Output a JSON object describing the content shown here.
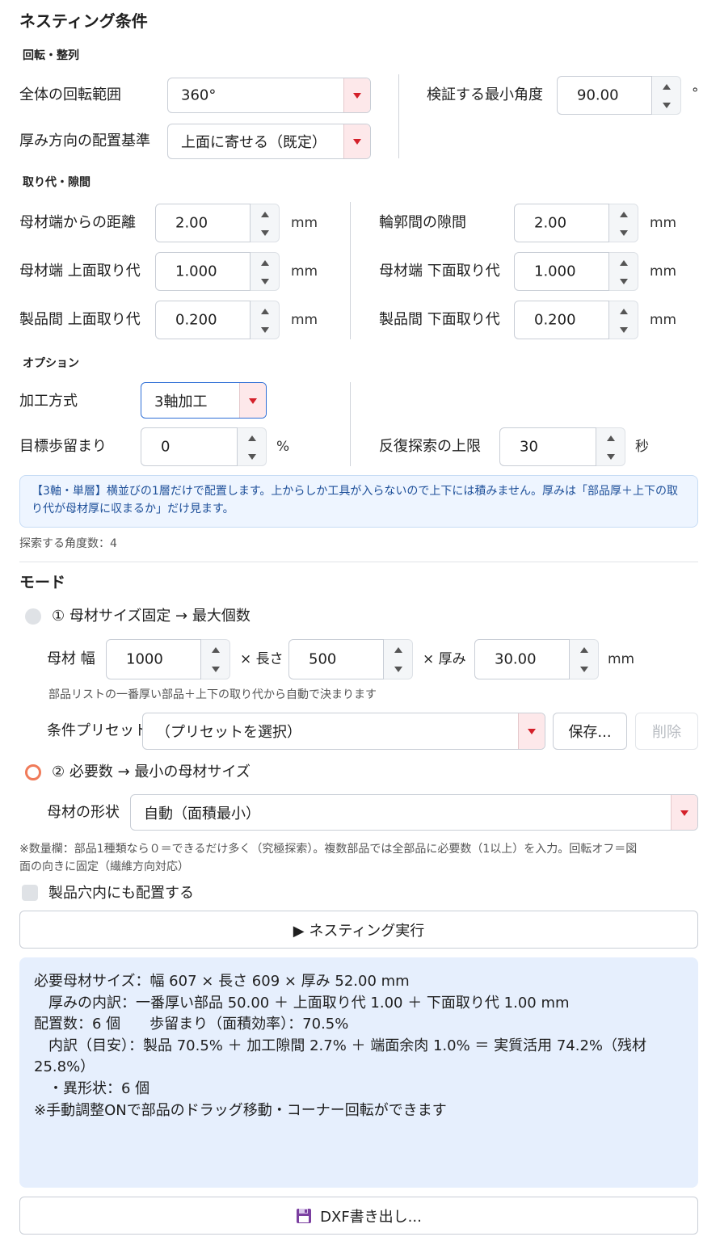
{
  "title": "ネスティング条件",
  "rotation_section": {
    "heading": "回転・整列",
    "overall_rotation_label": "全体の回転範囲",
    "overall_rotation_value": "360°",
    "thickness_align_label": "厚み方向の配置基準",
    "thickness_align_value": "上面に寄せる（既定）",
    "min_angle_label": "検証する最小角度",
    "min_angle_value": "90.00",
    "min_angle_unit": "°"
  },
  "allowance_section": {
    "heading": "取り代・隙間",
    "stock_edge_label": "母材端からの距離",
    "stock_edge_value": "2.00",
    "outline_gap_label": "輪郭間の隙間",
    "outline_gap_value": "2.00",
    "stock_top_label": "母材端 上面取り代",
    "stock_top_value": "1.000",
    "stock_bottom_label": "母材端 下面取り代",
    "stock_bottom_value": "1.000",
    "part_top_label": "製品間 上面取り代",
    "part_top_value": "0.200",
    "part_bottom_label": "製品間 下面取り代",
    "part_bottom_value": "0.200",
    "unit": "mm"
  },
  "options_section": {
    "heading": "オプション",
    "machining_label": "加工方式",
    "machining_value": "3軸加工",
    "yield_label": "目標歩留まり",
    "yield_value": "0",
    "yield_unit": "%",
    "iter_label": "反復探索の上限",
    "iter_value": "30",
    "iter_unit": "秒",
    "info_line1": "【3軸・単層】横並びの1層だけで配置します。上からしか工具が入らないので上下には積みません。厚みは「部品厚＋上下の取",
    "info_line2": "り代が母材厚に収まるか」だけ見ます。",
    "angle_count": "探索する角度数：4"
  },
  "mode_section": {
    "heading": "モード",
    "mode1_label": "① 母材サイズ固定 → 最大個数",
    "stock_width_label": "母材 幅",
    "stock_width_value": "1000",
    "length_label": "× 長さ",
    "length_value": "500",
    "thickness_label": "× 厚み",
    "thickness_value": "30.00",
    "unit": "mm",
    "auto_note": "部品リストの一番厚い部品＋上下の取り代から自動で決まります",
    "preset_label": "条件プリセット",
    "preset_value": "（プリセットを選択）",
    "save_label": "保存...",
    "delete_label": "削除",
    "mode2_label": "② 必要数 → 最小の母材サイズ",
    "shape_label": "母材の形状",
    "shape_value": "自動（面積最小）",
    "note_line1": "※数量欄：部品1種類なら０＝できるだけ多く（究極探索）。複数部品では全部品に必要数（1以上）を入力。回転オフ＝図",
    "note_line2": "面の向きに固定（繊維方向対応）",
    "holes_label": "製品穴内にも配置する",
    "run_label": "▶ ネスティング実行"
  },
  "result": {
    "line1": "必要母材サイズ：幅 607 × 長さ 609 × 厚み 52.00 mm",
    "line2": "　厚みの内訳：一番厚い部品 50.00 ＋ 上面取り代 1.00 ＋ 下面取り代 1.00 mm",
    "line3": "配置数：6 個　　歩留まり（面積効率）：70.5%",
    "line4": "　内訳（目安）：製品 70.5% ＋ 加工隙間 2.7% ＋ 端面余肉 1.0% ＝ 実質活用 74.2%（残材",
    "line5": "25.8%）",
    "line6": "　・異形状：6 個",
    "line7": "※手動調整ONで部品のドラッグ移動・コーナー回転ができます"
  },
  "export": {
    "label": "DXF書き出し..."
  },
  "colors": {
    "accent_red": "#d4202a",
    "radio_selected": "#f07b5a",
    "info_bg": "#eef5ff",
    "result_bg": "#e6effd",
    "focus_blue": "#2f6fd6"
  }
}
